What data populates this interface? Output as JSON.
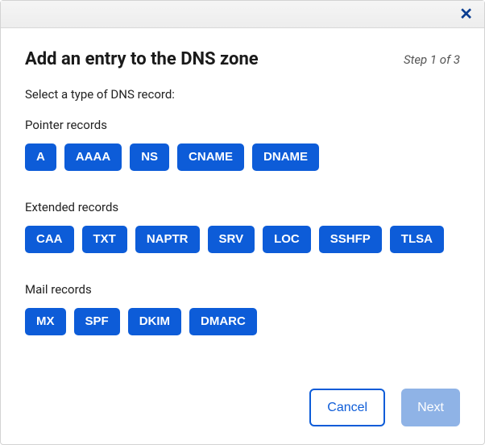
{
  "header": {
    "title": "Add an entry to the DNS zone",
    "step": "Step 1 of 3"
  },
  "instruction": "Select a type of DNS record:",
  "groups": [
    {
      "title": "Pointer records",
      "items": [
        "A",
        "AAAA",
        "NS",
        "CNAME",
        "DNAME"
      ]
    },
    {
      "title": "Extended records",
      "items": [
        "CAA",
        "TXT",
        "NAPTR",
        "SRV",
        "LOC",
        "SSHFP",
        "TLSA"
      ]
    },
    {
      "title": "Mail records",
      "items": [
        "MX",
        "SPF",
        "DKIM",
        "DMARC"
      ]
    }
  ],
  "footer": {
    "cancel": "Cancel",
    "next": "Next"
  }
}
